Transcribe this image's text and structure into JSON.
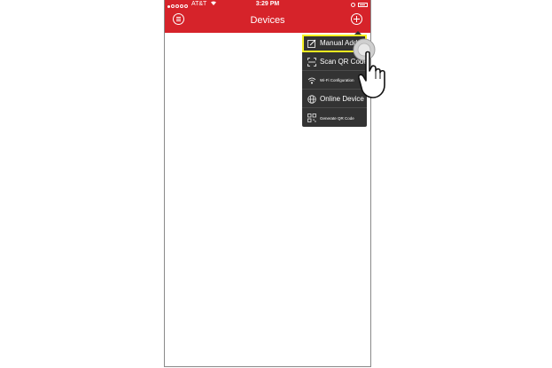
{
  "status": {
    "carrier": "AT&T",
    "time": "3:29 PM"
  },
  "nav": {
    "title": "Devices"
  },
  "menu": {
    "items": [
      {
        "label": "Manual Add",
        "icon": "pencil-edit-icon"
      },
      {
        "label": "Scan QR Code",
        "icon": "scan-icon"
      },
      {
        "label": "Wi-Fi Configuration",
        "icon": "wifi-icon"
      },
      {
        "label": "Online Device",
        "icon": "globe-icon"
      },
      {
        "label": "Generate QR Code",
        "icon": "qr-code-icon"
      }
    ]
  },
  "colors": {
    "header_red": "#d6232a",
    "menu_bg": "#333333",
    "highlight": "#f5ef20"
  }
}
